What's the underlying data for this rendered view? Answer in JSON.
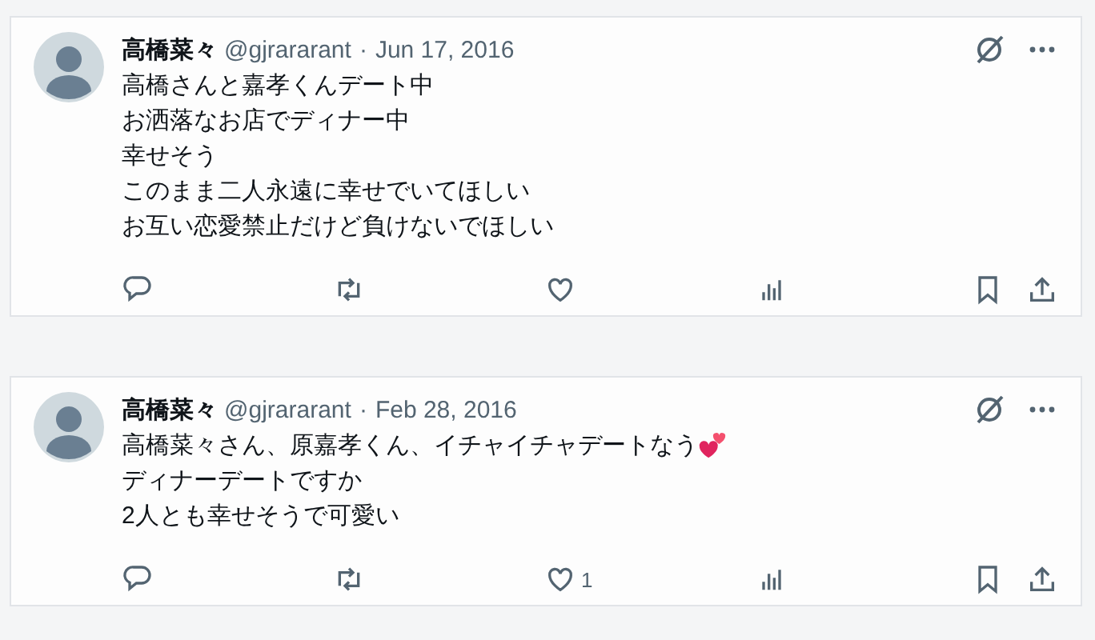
{
  "posts": [
    {
      "author": "高橋菜々",
      "handle": "@gjrararant",
      "separator": "·",
      "date": "Jun 17, 2016",
      "lines": [
        {
          "kind": "plain",
          "text": "高橋さんと嘉孝くんデート中"
        },
        {
          "kind": "plain",
          "text": "お洒落なお店でディナー中"
        },
        {
          "kind": "plain",
          "text": "幸せそう"
        },
        {
          "kind": "plain",
          "text": "このまま二人永遠に幸せでいてほしい"
        },
        {
          "kind": "plain",
          "text": "お互い恋愛禁止だけど負けないでほしい"
        }
      ]
    },
    {
      "author": "高橋菜々",
      "handle": "@gjrararant",
      "separator": "·",
      "date": "Feb 28, 2016",
      "lines": [
        {
          "kind": "hearts",
          "text": "高橋菜々さん、原嘉孝くん、イチャイチャデートなう"
        },
        {
          "kind": "plain",
          "text": "ディナーデートですか"
        },
        {
          "kind": "plain",
          "text": "2人とも幸せそうで可愛い"
        }
      ],
      "likes": "1"
    }
  ]
}
